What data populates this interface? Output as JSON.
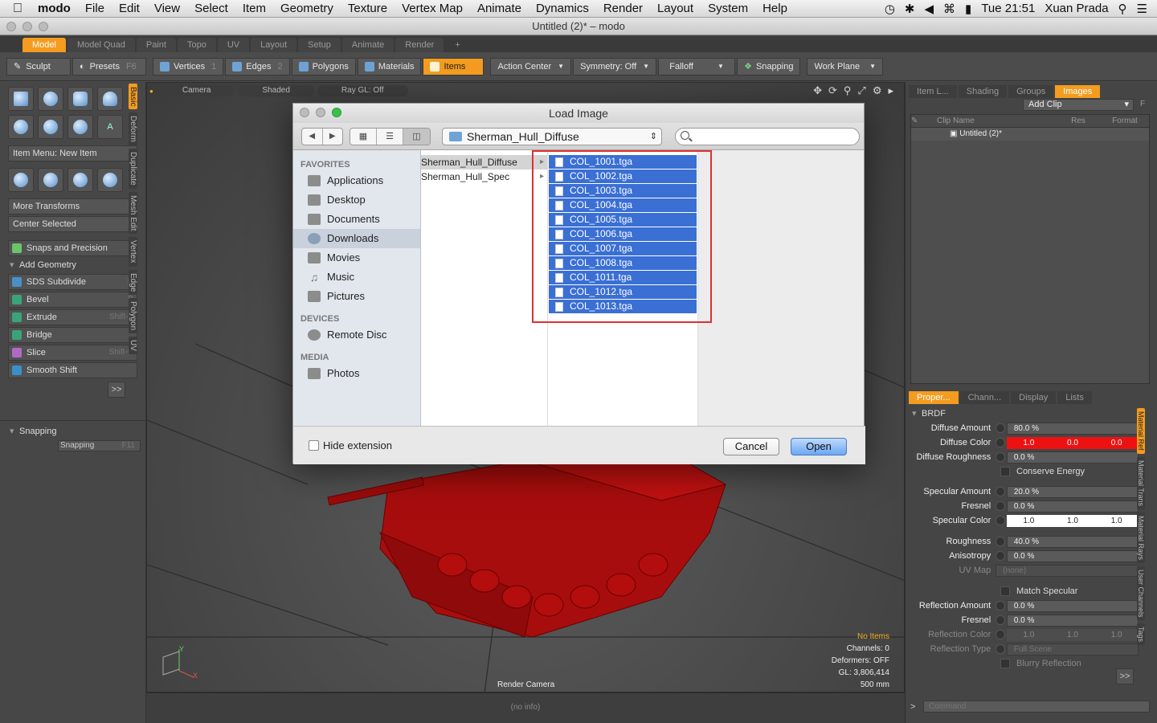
{
  "menubar": {
    "app": "modo",
    "items": [
      "File",
      "Edit",
      "View",
      "Select",
      "Item",
      "Geometry",
      "Texture",
      "Vertex Map",
      "Animate",
      "Dynamics",
      "Render",
      "Layout",
      "System",
      "Help"
    ],
    "clock": "Tue 21:51",
    "user": "Xuan Prada"
  },
  "window": {
    "title": "Untitled (2)* – modo"
  },
  "layout_tabs": [
    "Model",
    "Model Quad",
    "Paint",
    "Topo",
    "UV",
    "Layout",
    "Setup",
    "Animate",
    "Render",
    "+"
  ],
  "toolbar": {
    "sculpt": "Sculpt",
    "presets": "Presets",
    "presets_key": "F6",
    "vertices": "Vertices",
    "vertices_num": "1",
    "edges": "Edges",
    "edges_num": "2",
    "polygons": "Polygons",
    "materials": "Materials",
    "items": "Items",
    "action_center": "Action Center",
    "symmetry": "Symmetry: Off",
    "falloff": "Falloff",
    "snapping": "Snapping",
    "work_plane": "Work Plane"
  },
  "left_panel": {
    "item_menu": "Item Menu: New Item",
    "more_transforms": "More Transforms",
    "center_selected": "Center Selected",
    "snaps_precision": "Snaps and Precision",
    "add_geometry": "Add Geometry",
    "tools": [
      {
        "label": "SDS Subdivide",
        "key": "D"
      },
      {
        "label": "Bevel",
        "key": "B"
      },
      {
        "label": "Extrude",
        "key": "Shift-X"
      },
      {
        "label": "Bridge",
        "key": ""
      },
      {
        "label": "Slice",
        "key": "Shift-C"
      },
      {
        "label": "Smooth Shift",
        "key": ""
      }
    ],
    "more": ">>",
    "snapping_section": "Snapping",
    "snapping_btn": "Snapping",
    "snapping_key": "F11",
    "vtabs": [
      "Basic",
      "Deform",
      "Duplicate",
      "Mesh Edit",
      "Vertex",
      "Edge",
      "Polygon",
      "UV"
    ]
  },
  "viewport": {
    "buttons": [
      "Camera",
      "Shaded",
      "Ray GL: Off"
    ],
    "info": {
      "noitems": "No Items",
      "channels": "Channels: 0",
      "deformers": "Deformers: OFF",
      "gl": "GL: 3,806,414",
      "scale": "500 mm"
    },
    "camera_label": "Render Camera",
    "status": "(no info)",
    "axis_y": "Y",
    "axis_x": "X"
  },
  "right_panel": {
    "top_tabs": [
      "Item L...",
      "Shading",
      "Groups",
      "Images"
    ],
    "add_clip": "Add Clip",
    "add_clip_key": "F",
    "columns": [
      "Clip Name",
      "Res",
      "Format"
    ],
    "clip_row": "Untitled (2)*",
    "bottom_tabs": [
      "Proper...",
      "Chann...",
      "Display",
      "Lists"
    ],
    "brdf": "BRDF",
    "properties": {
      "diffuse_amount": {
        "label": "Diffuse Amount",
        "value": "80.0 %"
      },
      "diffuse_color": {
        "label": "Diffuse Color",
        "r": "1.0",
        "g": "0.0",
        "b": "0.0"
      },
      "diffuse_roughness": {
        "label": "Diffuse Roughness",
        "value": "0.0 %"
      },
      "conserve_energy": "Conserve Energy",
      "specular_amount": {
        "label": "Specular Amount",
        "value": "20.0 %"
      },
      "fresnel": {
        "label": "Fresnel",
        "value": "0.0 %"
      },
      "specular_color": {
        "label": "Specular Color",
        "r": "1.0",
        "g": "1.0",
        "b": "1.0"
      },
      "roughness": {
        "label": "Roughness",
        "value": "40.0 %"
      },
      "anisotropy": {
        "label": "Anisotropy",
        "value": "0.0 %"
      },
      "uv_map": {
        "label": "UV Map",
        "value": "(none)"
      },
      "match_specular": "Match Specular",
      "reflection_amount": {
        "label": "Reflection Amount",
        "value": "0.0 %"
      },
      "fresnel2": {
        "label": "Fresnel",
        "value": "0.0 %"
      },
      "reflection_color": {
        "label": "Reflection Color",
        "r": "1.0",
        "g": "1.0",
        "b": "1.0"
      },
      "reflection_type": {
        "label": "Reflection Type",
        "value": "Full Scene"
      },
      "blurry_reflection": "Blurry Reflection"
    },
    "side_tabs": [
      "Material Ref",
      "Material Trans",
      "Material Rays",
      "User Channels",
      "Tags"
    ],
    "command_placeholder": "Command",
    "more": ">>"
  },
  "dialog": {
    "title": "Load Image",
    "path": "Sherman_Hull_Diffuse",
    "search_placeholder": "",
    "favorites_header": "FAVORITES",
    "favorites": [
      "Applications",
      "Desktop",
      "Documents",
      "Downloads",
      "Movies",
      "Music",
      "Pictures"
    ],
    "selected_favorite": "Downloads",
    "devices_header": "DEVICES",
    "devices": [
      "Remote Disc"
    ],
    "media_header": "MEDIA",
    "media": [
      "Photos"
    ],
    "folders": [
      "Sherman_Hull_Diffuse",
      "Sherman_Hull_Spec"
    ],
    "files": [
      "COL_1001.tga",
      "COL_1002.tga",
      "COL_1003.tga",
      "COL_1004.tga",
      "COL_1005.tga",
      "COL_1006.tga",
      "COL_1007.tga",
      "COL_1008.tga",
      "COL_1011.tga",
      "COL_1012.tga",
      "COL_1013.tga"
    ],
    "hide_extension": "Hide extension",
    "cancel": "Cancel",
    "open": "Open"
  },
  "colors": {
    "accent": "#f39c1f",
    "selection": "#3a6fd4",
    "highlight_box": "#e03030",
    "diffuse_red": "#ee1111"
  }
}
